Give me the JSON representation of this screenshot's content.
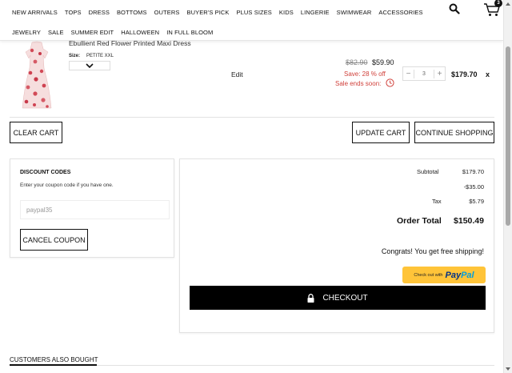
{
  "nav": {
    "row1": [
      "NEW ARRIVALS",
      "TOPS",
      "DRESS",
      "BOTTOMS",
      "OUTERS",
      "BUYER'S PICK",
      "PLUS SIZES",
      "KIDS",
      "LINGERIE",
      "SWIMWEAR",
      "ACCESSORIES"
    ],
    "row2": [
      "JEWELRY",
      "SALE",
      "SUMMER EDIT",
      "HALLOWEEN",
      "IN FULL BLOOM"
    ],
    "cart_count": "3"
  },
  "item": {
    "title": "Ebullient Red Flower Printed Maxi Dress",
    "size_label": "Size:",
    "size_value": "PETITE XXL",
    "edit_label": "Edit",
    "price_old": "$82.90",
    "price_new": "$59.90",
    "save_text": "Save: 28 % off",
    "sale_ends": "Sale ends soon:",
    "qty": "3",
    "qty_minus": "−",
    "qty_plus": "+",
    "line_total": "$179.70",
    "remove": "x"
  },
  "buttons": {
    "clear_cart": "CLEAR CART",
    "update_cart": "UPDATE CART",
    "continue_shopping": "CONTINUE SHOPPING"
  },
  "discount": {
    "title": "DISCOUNT CODES",
    "description": "Enter your coupon code if you have one.",
    "coupon_value": "paypal35",
    "cancel_label": "CANCEL COUPON"
  },
  "summary": {
    "subtotal_label": "Subtotal",
    "subtotal_value": "$179.70",
    "discount_value": "-$35.00",
    "tax_label": "Tax",
    "tax_value": "$5.79",
    "order_total_label": "Order Total",
    "order_total_value": "$150.49",
    "congrats": "Congrats! You get free shipping!",
    "paypal_prefix": "Check out with",
    "paypal_word1": "Pay",
    "paypal_word2": "Pal",
    "checkout_label": "CHECKOUT"
  },
  "also_bought": "CUSTOMERS ALSO BOUGHT",
  "colors": {
    "sale_red": "#d0413b",
    "paypal_yellow": "#ffc439",
    "checkout_black": "#000000"
  }
}
